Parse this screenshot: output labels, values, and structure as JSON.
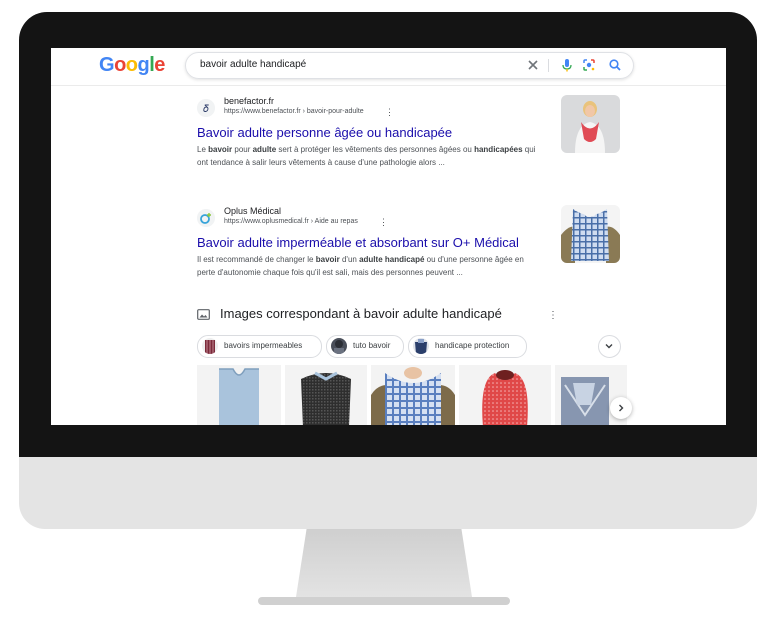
{
  "search": {
    "logo_letters": [
      "G",
      "o",
      "o",
      "g",
      "l",
      "e"
    ],
    "query": "bavoir adulte handicapé",
    "icons": [
      "close-icon",
      "microphone-icon",
      "camera-lens-icon",
      "search-icon"
    ]
  },
  "results": [
    {
      "site_name": "benefactor.fr",
      "url": "https://www.benefactor.fr › bavoir-pour-adulte",
      "title": "Bavoir adulte personne âgée ou handicapée",
      "snippet_html": "Le <b>bavoir</b> pour <b>adulte</b> sert à protéger les vêtements des personnes âgées ou <b>handicapées</b> qui ont tendance à salir leurs vêtements à cause d'une pathologie alors ..."
    },
    {
      "site_name": "Oplus Médical",
      "url": "https://www.oplusmedical.fr › Aide au repas",
      "title": "Bavoir adulte imperméable et absorbant sur O+ Médical",
      "snippet_html": "Il est recommandé de changer le <b>bavoir</b> d'un <b>adulte handicapé</b> ou d'une personne âgée en perte d'autonomie chaque fois qu'il est sali, mais des personnes peuvent ..."
    }
  ],
  "images_section": {
    "title": "Images correspondant à bavoir adulte handicapé",
    "chips": [
      "bavoirs impermeables",
      "tuto bavoir",
      "handicape protection"
    ]
  },
  "colors": {
    "link": "#1a0dab",
    "snippet": "#4d5156",
    "frame": "#141414",
    "stand": "#e4e4e4"
  }
}
